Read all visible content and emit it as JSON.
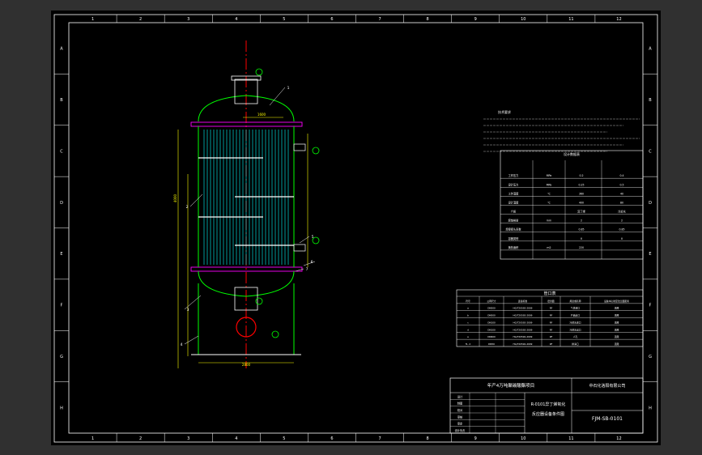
{
  "colors": {
    "sheet": "#000000",
    "frame": "#ffffff",
    "vessel": "#00ff00",
    "tubes": "#00ffff",
    "baffles": "#ff00ff",
    "centerline": "#ff0000",
    "dims": "#ffff00",
    "text": "#ffffff",
    "bg": "#303030"
  },
  "border_columns": [
    "1",
    "2",
    "3",
    "4",
    "5",
    "6",
    "7",
    "8",
    "9",
    "10",
    "11",
    "12"
  ],
  "border_rows": [
    "A",
    "B",
    "C",
    "D",
    "E",
    "F",
    "G",
    "H"
  ],
  "title_block": {
    "project": "年产4万吨聚碳酸酯项目",
    "company": "中石化洛阳有限公司",
    "drawing_title_line1": "R-0101异丁烯氧化",
    "drawing_title_line2": "反应器设备条件图",
    "drawing_number": "FJM-SB-0101",
    "roles": [
      "设计",
      "制图",
      "校对",
      "审核",
      "审定",
      "设计负责"
    ],
    "role_values": [
      "",
      "",
      "",
      "",
      "",
      ""
    ]
  },
  "nozzle_table": {
    "title": "管口表",
    "header": [
      "符号",
      "公称尺寸",
      "连接标准",
      "密封面",
      "用途或名称",
      "设备中心线至法兰面距离"
    ],
    "rows": [
      [
        "a",
        "DN500",
        "HG/T20592-2009",
        "RF",
        "气体进口",
        "见图"
      ],
      [
        "b",
        "DN500",
        "HG/T20592-2009",
        "RF",
        "产品出口",
        "见图"
      ],
      [
        "c",
        "DN100",
        "HG/T20592-2009",
        "RF",
        "冷却水进口",
        "见图"
      ],
      [
        "d",
        "DN100",
        "HG/T20592-2009",
        "RF",
        "冷却水出口",
        "见图"
      ],
      [
        "e",
        "DN600",
        "HG/T20592-2009",
        "RF",
        "人孔",
        "见图"
      ],
      [
        "f1, 2",
        "DN50",
        "HG/T20592-2009",
        "RF",
        "排净口",
        "见图"
      ]
    ]
  },
  "design_table": {
    "title": "设计数据表",
    "rows": [
      [
        "工作压力",
        "MPa",
        "0.2",
        "0.4"
      ],
      [
        "设计压力",
        "MPa",
        "0.25",
        "0.5"
      ],
      [
        "工作温度",
        "℃",
        "360",
        "40"
      ],
      [
        "设计温度",
        "℃",
        "400",
        "80"
      ],
      [
        "介质",
        "",
        "异丁烯",
        "冷却水"
      ],
      [
        "腐蚀裕量",
        "mm",
        "2",
        "2"
      ],
      [
        "焊接接头系数",
        "",
        "0.85",
        "0.85"
      ],
      [
        "容器类别",
        "",
        "II",
        "II"
      ],
      [
        "换热面积",
        "m2",
        "220",
        ""
      ]
    ]
  },
  "notes_heading": "技术要求",
  "labels": [
    "1",
    "2",
    "3",
    "4",
    "5",
    "6",
    "7",
    "8",
    "9",
    "10",
    "11"
  ],
  "dimensions": {
    "shell_width": "1600",
    "overall_width": "2800",
    "tube_length": "4000"
  }
}
